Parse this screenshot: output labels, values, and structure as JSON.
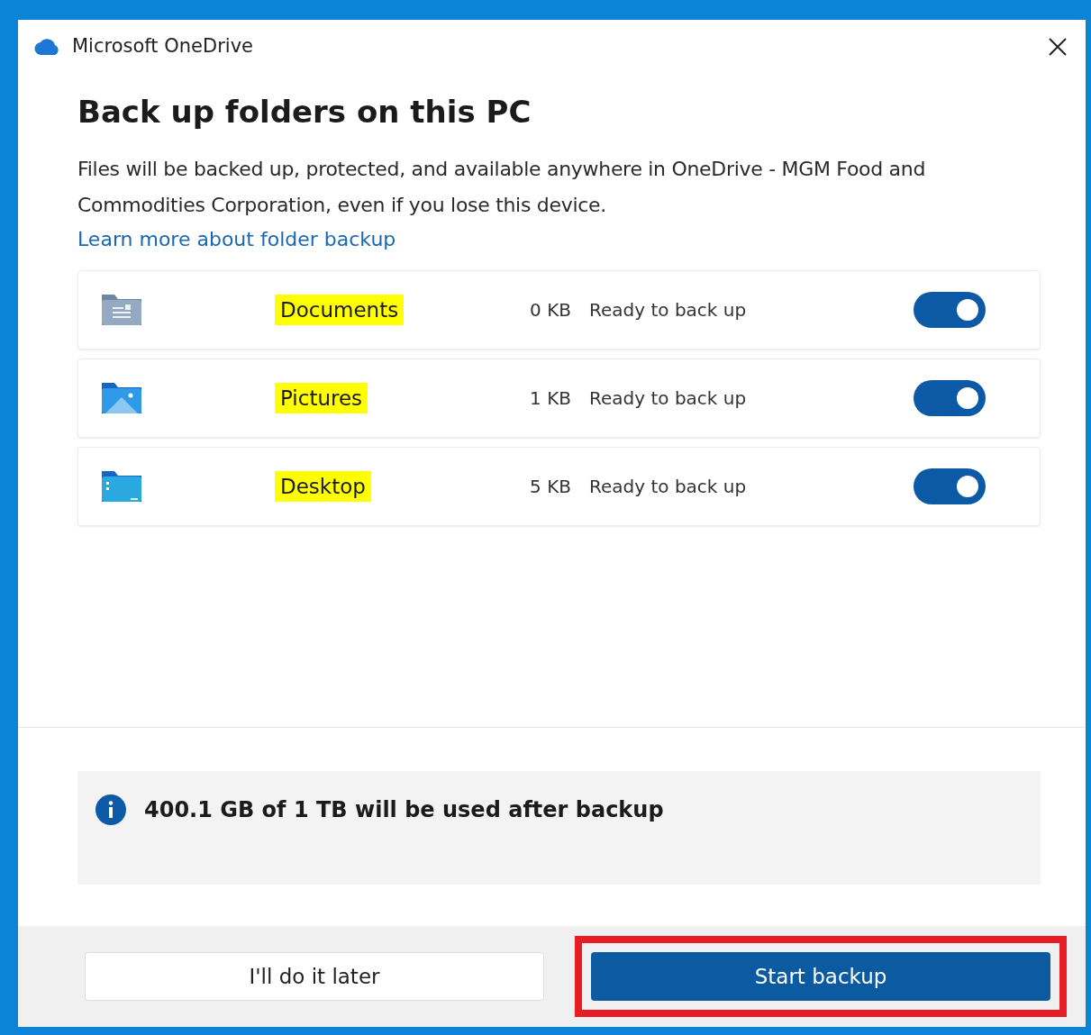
{
  "window": {
    "title": "Microsoft OneDrive"
  },
  "heading": "Back up folders on this PC",
  "description": "Files will be backed up, protected, and available anywhere in OneDrive - MGM Food and Commodities Corporation, even if you lose this device.",
  "link": "Learn more about folder backup",
  "folders": [
    {
      "kind": "documents",
      "name": "Documents",
      "highlighted": true,
      "size": "0 KB",
      "status": "Ready to back up",
      "on": true
    },
    {
      "kind": "pictures",
      "name": "Pictures",
      "highlighted": true,
      "size": "1 KB",
      "status": "Ready to back up",
      "on": true
    },
    {
      "kind": "desktop",
      "name": "Desktop",
      "highlighted": true,
      "size": "5 KB",
      "status": "Ready to back up",
      "on": true
    }
  ],
  "info": "400.1 GB of 1 TB will be used after backup",
  "buttons": [
    {
      "label": "I'll do it later",
      "kind": "secondary",
      "marked": false
    },
    {
      "label": "Start backup",
      "kind": "primary",
      "marked": true
    }
  ]
}
